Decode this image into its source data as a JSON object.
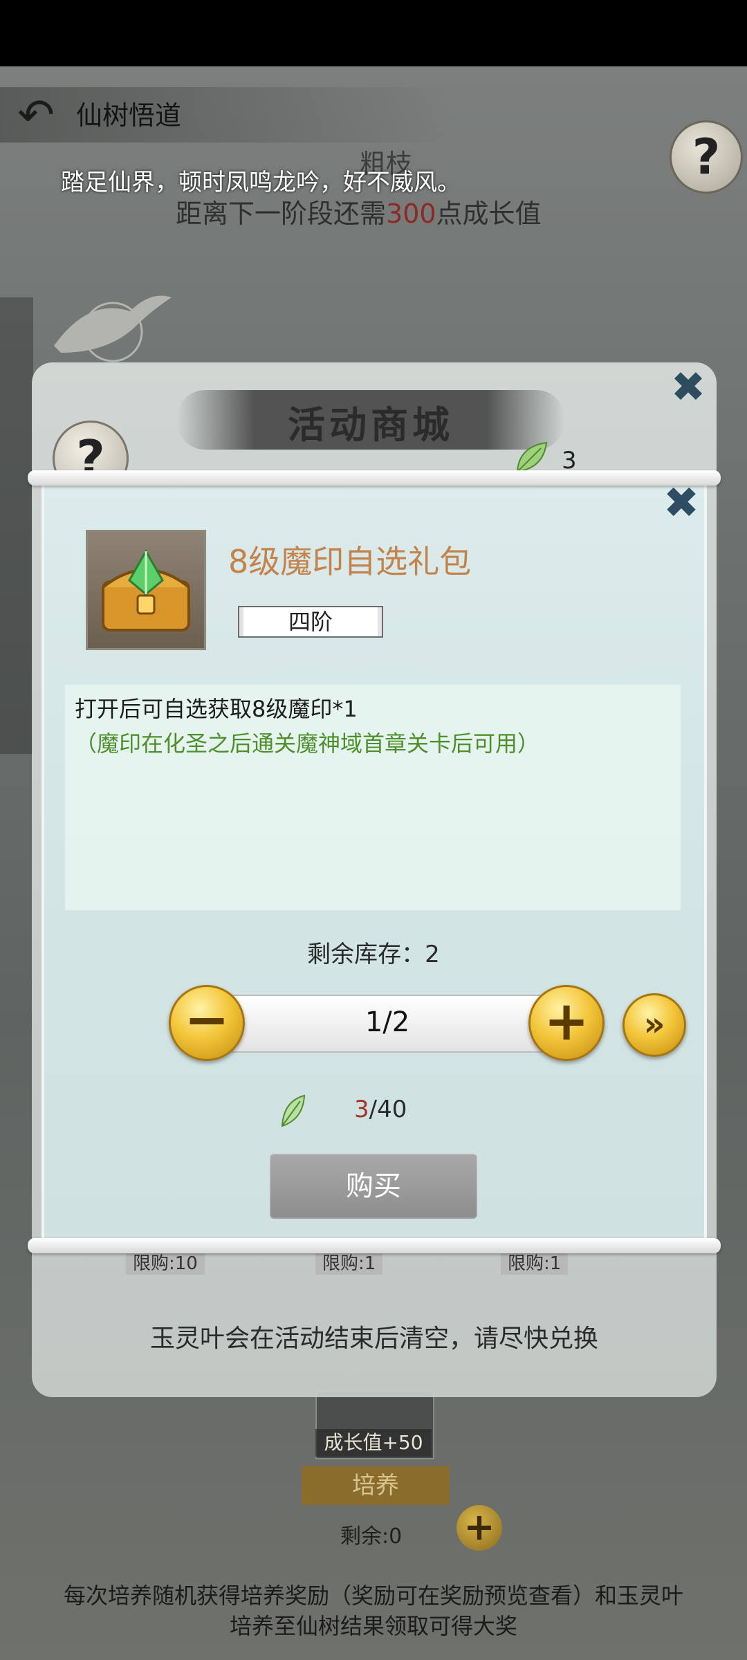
{
  "background": {
    "title": "仙树悟道",
    "stage_name": "粗枝",
    "progress": {
      "prefix": "距离下一阶段还需",
      "value": "300",
      "suffix": "点成长值"
    },
    "scroll_text": "踏足仙界，顿时凤鸣龙吟，好不威风。",
    "growth_label": "成长值+50",
    "cultivate_label": "培养",
    "remaining_label": "剩余:0",
    "footer_line1": "每次培养随机获得培养奖励（奖励可在奖励预览查看）和玉灵叶",
    "footer_line2": "培养至仙树结果领取可得大奖"
  },
  "shop": {
    "title": "活动商城",
    "leaf_count": "3",
    "notice": "玉灵叶会在活动结束后清空，请尽快兑换",
    "limit_labels": [
      "限购:10",
      "限购:1",
      "限购:1"
    ]
  },
  "item": {
    "name": "8级魔印自选礼包",
    "grade": "四阶",
    "desc_line1": "打开后可自选获取8级魔印*1",
    "desc_line2": "（魔印在化圣之后通关魔神域首章关卡后可用）",
    "stock_label": "剩余库存：2",
    "quantity": "1/2",
    "price_owned": "3",
    "price_total": "/40",
    "buy_label": "购买"
  },
  "colors": {
    "item_name": "#c4834a",
    "desc_note": "#4f8f2b",
    "price_red": "#a33328",
    "gold_button": "#f3c63a"
  },
  "icons": [
    "back-arrow-icon",
    "help-icon",
    "close-icon",
    "leaf-icon",
    "minus-icon",
    "plus-icon",
    "double-chevron-right-icon",
    "treasure-chest-icon"
  ]
}
